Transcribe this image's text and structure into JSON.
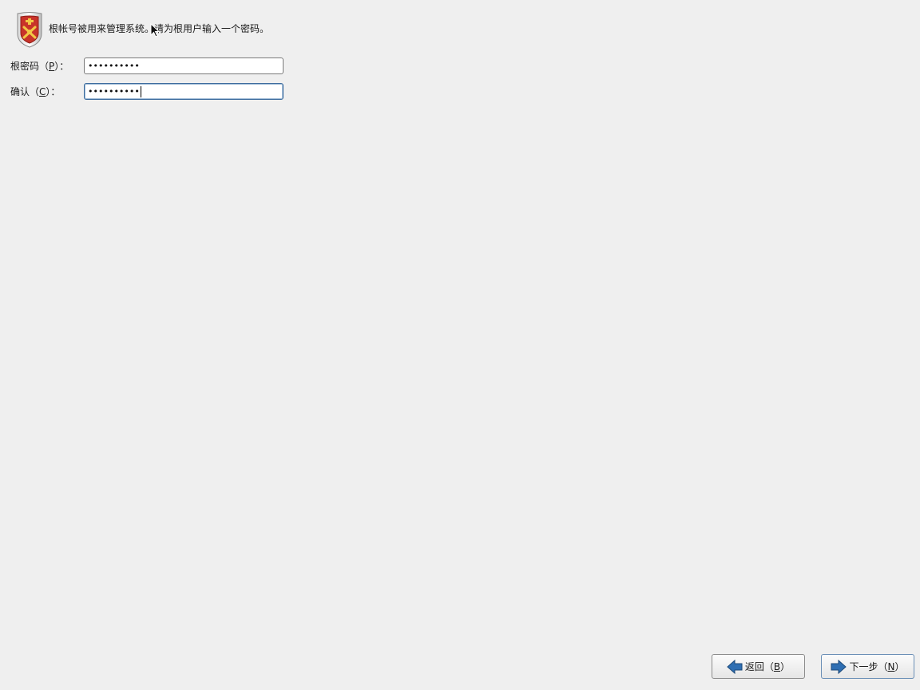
{
  "header": {
    "icon": "shield-icon",
    "message": "根帐号被用来管理系统。请为根用户输入一个密码。"
  },
  "form": {
    "password": {
      "label_prefix": "根密码（",
      "label_mnemonic": "P",
      "label_suffix": "）：",
      "value_masked": "••••••••••"
    },
    "confirm": {
      "label_prefix": "确认（",
      "label_mnemonic": "C",
      "label_suffix": "）：",
      "value_masked": "••••••••••"
    }
  },
  "buttons": {
    "back": {
      "label_prefix": "返回（",
      "mnemonic": "B",
      "label_suffix": "）",
      "icon": "arrow-left-icon"
    },
    "next": {
      "label_prefix": "下一步（",
      "mnemonic": "N",
      "label_suffix": "）",
      "icon": "arrow-right-icon"
    }
  },
  "colors": {
    "background": "#efefef",
    "arrow_blue": "#2f6fb3",
    "shield_red": "#c8332a"
  }
}
